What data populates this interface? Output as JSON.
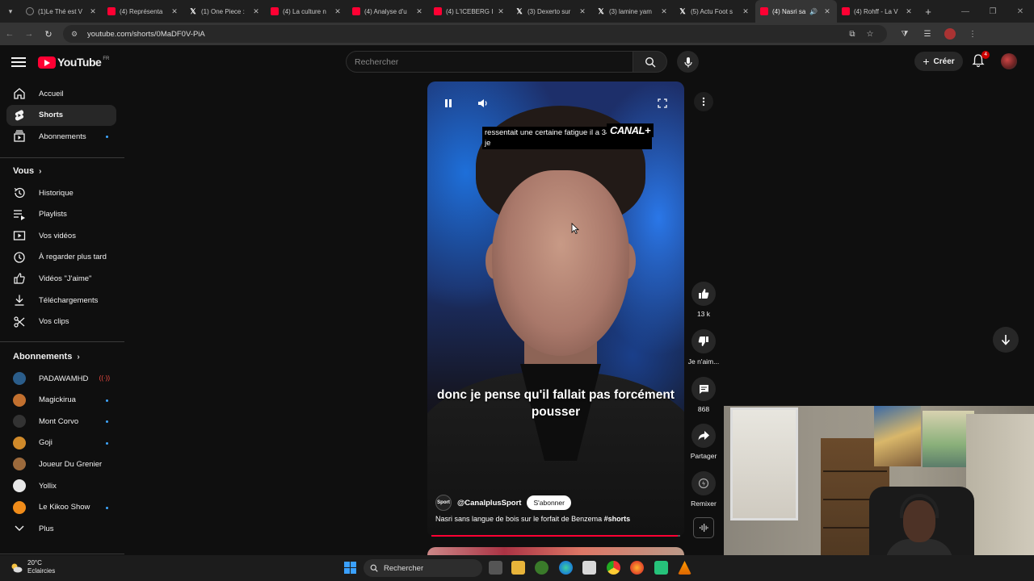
{
  "browser": {
    "tabs": [
      {
        "title": "(1)Le Thé est V",
        "favicon": "twitch"
      },
      {
        "title": "(4) Représenta",
        "favicon": "youtube"
      },
      {
        "title": "(1) One Piece :",
        "favicon": "x"
      },
      {
        "title": "(4) La culture n",
        "favicon": "youtube"
      },
      {
        "title": "(4) Analyse d'u",
        "favicon": "youtube"
      },
      {
        "title": "(4) L'ICEBERG I",
        "favicon": "youtube"
      },
      {
        "title": "(3) Dexerto sur",
        "favicon": "x"
      },
      {
        "title": "(3) lamine yam",
        "favicon": "x"
      },
      {
        "title": "(5) Actu Foot s",
        "favicon": "x"
      },
      {
        "title": "(4) Nasri sa",
        "favicon": "youtube",
        "active": true,
        "audio": true
      },
      {
        "title": "(4) Rohff - La V",
        "favicon": "youtube"
      }
    ],
    "url": "youtube.com/shorts/0MaDF0V-PiA"
  },
  "header": {
    "logo_text": "YouTube",
    "country_code": "FR",
    "search_placeholder": "Rechercher",
    "create_label": "Créer",
    "notification_count": "4"
  },
  "sidebar": {
    "main": [
      {
        "label": "Accueil",
        "icon": "home-icon"
      },
      {
        "label": "Shorts",
        "icon": "shorts-icon",
        "active": true
      },
      {
        "label": "Abonnements",
        "icon": "subscriptions-icon",
        "dot": true
      }
    ],
    "you_header": "Vous",
    "you": [
      {
        "label": "Historique",
        "icon": "history-icon"
      },
      {
        "label": "Playlists",
        "icon": "playlists-icon"
      },
      {
        "label": "Vos vidéos",
        "icon": "your-videos-icon"
      },
      {
        "label": "À regarder plus tard",
        "icon": "watch-later-icon"
      },
      {
        "label": "Vidéos \"J'aime\"",
        "icon": "liked-icon"
      },
      {
        "label": "Téléchargements",
        "icon": "downloads-icon"
      },
      {
        "label": "Vos clips",
        "icon": "clips-icon"
      }
    ],
    "subs_header": "Abonnements",
    "subs": [
      {
        "label": "PADAWAMHD",
        "color": "#2b5d8a",
        "live": true
      },
      {
        "label": "Magickirua",
        "color": "#c2702f",
        "dot": true
      },
      {
        "label": "Mont Corvo",
        "color": "#333333",
        "dot": true
      },
      {
        "label": "Goji",
        "color": "#d08a2a",
        "dot": true
      },
      {
        "label": "Joueur Du Grenier",
        "color": "#9c6a3c"
      },
      {
        "label": "Yollix",
        "color": "#e8e8e8"
      },
      {
        "label": "Le Kikoo Show",
        "color": "#f08c1a",
        "dot": true
      }
    ],
    "more_label": "Plus"
  },
  "video": {
    "top_subtitle": "ressentait une certaine fatigue il a 34 ans donc je",
    "broadcaster": "CANAL+",
    "caption": "donc je pense qu'il fallait pas forcément pousser",
    "channel_avatar_text": "Sport",
    "channel": "@CanalplusSport",
    "subscribe_label": "S'abonner",
    "title": "Nasri sans langue de bois sur le forfait de Benzema",
    "hashtag": "#shorts",
    "progress": 0.99
  },
  "actions": {
    "like_count": "13 k",
    "dislike_label": "Je n'aim...",
    "comments_count": "868",
    "share_label": "Partager",
    "remix_label": "Remixer"
  },
  "taskbar": {
    "temperature": "20°C",
    "weather": "Eclaircies",
    "search_label": "Rechercher"
  }
}
